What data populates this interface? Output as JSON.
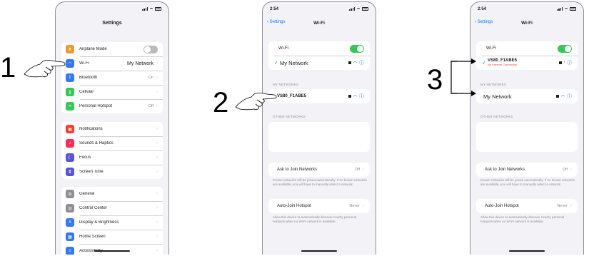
{
  "screens": {
    "settings": {
      "title": "Settings",
      "groups": [
        [
          {
            "label": "Airplane Mode",
            "icon": "airplane-icon",
            "color": "#f09a37",
            "toggle": "off"
          },
          {
            "label": "Wi-Fi",
            "icon": "wifi-icon",
            "color": "#3478f6",
            "value": "My Network"
          },
          {
            "label": "Bluetooth",
            "icon": "bluetooth-icon",
            "color": "#3478f6",
            "value": "On"
          },
          {
            "label": "Cellular",
            "icon": "cellular-icon",
            "color": "#34c759",
            "value": ""
          },
          {
            "label": "Personal Hotspot",
            "icon": "hotspot-icon",
            "color": "#34c759",
            "value": "Off"
          }
        ],
        [
          {
            "label": "Notifications",
            "icon": "notifications-icon",
            "color": "#ff3b30",
            "value": ""
          },
          {
            "label": "Sounds & Haptics",
            "icon": "sounds-icon",
            "color": "#ff2d55",
            "value": ""
          },
          {
            "label": "Focus",
            "icon": "focus-icon",
            "color": "#5856d6",
            "value": ""
          },
          {
            "label": "Screen Time",
            "icon": "screen-time-icon",
            "color": "#5856d6",
            "value": ""
          }
        ],
        [
          {
            "label": "General",
            "icon": "general-icon",
            "color": "#8e8e93",
            "value": ""
          },
          {
            "label": "Control Center",
            "icon": "control-center-icon",
            "color": "#8e8e93",
            "value": ""
          },
          {
            "label": "Display & Brightness",
            "icon": "display-icon",
            "color": "#3478f6",
            "value": ""
          },
          {
            "label": "Home Screen",
            "icon": "home-screen-icon",
            "color": "#3478f6",
            "value": ""
          },
          {
            "label": "Accessibility",
            "icon": "accessibility-icon",
            "color": "#3478f6",
            "value": ""
          }
        ]
      ]
    },
    "wifi1": {
      "time": "2:54",
      "back": "Settings",
      "title": "Wi-Fi",
      "wifi_label": "Wi-Fi",
      "current_network": "My Network",
      "networks_header": "MY NETWORKS",
      "networks": [
        "VS80_F1ABE5"
      ],
      "other_header": "OTHER NETWORKS",
      "ask_label": "Ask to Join Networks",
      "ask_value": "Off",
      "ask_note": "Known networks will be joined automatically. If no known networks are available, you will have to manually select a network.",
      "hotspot_label": "Auto-Join Hotspot",
      "hotspot_value": "Never",
      "hotspot_note": "Allow this device to automatically discover nearby personal hotspots when no Wi-Fi network is available."
    },
    "wifi2": {
      "time": "2:54",
      "back": "Settings",
      "title": "Wi-Fi",
      "wifi_label": "Wi-Fi",
      "current_network": "VS80_F1ABE5",
      "current_sub": "No Internet Connection",
      "networks_header": "MY NETWORKS",
      "networks": [
        "My Network"
      ],
      "other_header": "OTHER NETWORKS",
      "ask_label": "Ask to Join Networks",
      "ask_value": "Off",
      "ask_note": "Known networks will be joined automatically. If no known networks are available, you will have to manually select a network.",
      "hotspot_label": "Auto-Join Hotspot",
      "hotspot_value": "Never",
      "hotspot_note": "Allow this device to automatically discover nearby personal hotspots when no Wi-Fi network is available."
    }
  },
  "steps": [
    "1",
    "2",
    "3"
  ]
}
